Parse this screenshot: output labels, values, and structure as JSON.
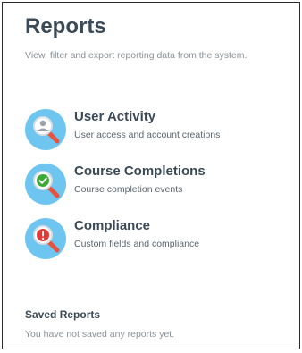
{
  "page": {
    "title": "Reports",
    "subtitle": "View, filter and export reporting data from the system."
  },
  "reports": [
    {
      "name": "User Activity",
      "description": "User access and account creations",
      "icon": "user-search-icon",
      "icon_color": "#4caf50"
    },
    {
      "name": "Course Completions",
      "description": "Course completion events",
      "icon": "check-search-icon",
      "icon_color": "#3aaa35"
    },
    {
      "name": "Compliance",
      "description": "Custom fields and compliance",
      "icon": "alert-search-icon",
      "icon_color": "#e53935"
    }
  ],
  "saved_reports": {
    "heading": "Saved Reports",
    "empty_message": "You have not saved any reports yet."
  },
  "colors": {
    "icon_background": "#6ec6f0",
    "heading_text": "#3b4a57",
    "muted_text": "#8a9298",
    "magnifier_handle": "#e8533f"
  }
}
